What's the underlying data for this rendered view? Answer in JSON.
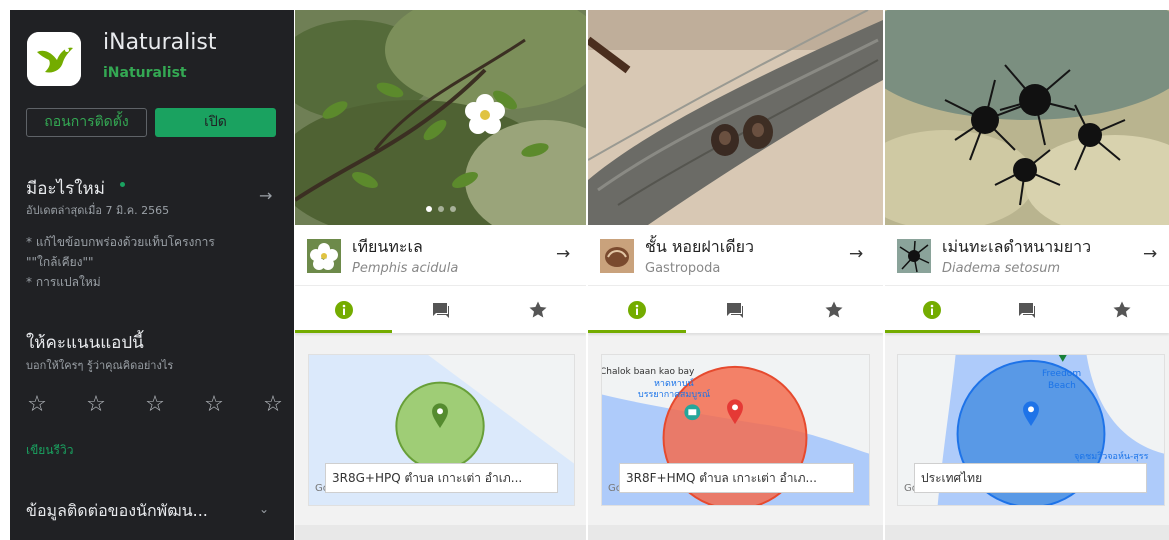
{
  "store": {
    "app_name": "iNaturalist",
    "developer": "iNaturalist",
    "uninstall_label": "ถอนการติดตั้ง",
    "open_label": "เปิด",
    "whats_new_title": "มีอะไรใหม่",
    "whats_new_arrow": "→",
    "whats_new_date": "อัปเดตล่าสุดเมื่อ 7 มิ.ค. 2565",
    "notes": [
      "* แก้ไขข้อบกพร่องด้วยแท็บโครงการ",
      "\"\"ใกล้เคียง\"\"",
      "* การแปลใหม่"
    ],
    "rate_title": "ให้คะแนนแอปนี้",
    "rate_subtitle": "บอกให้ใครๆ รู้ว่าคุณคิดอย่างไร",
    "stars": [
      "☆",
      "☆",
      "☆",
      "☆",
      "☆"
    ],
    "write_review_label": "เขียนรีวิว",
    "developer_contact_label": "ข้อมูลติดต่อของนักพัฒน...",
    "chevron": "⌄",
    "icons": {
      "app": "inaturalist-bird-icon",
      "star": "star-outline-icon",
      "arrow": "arrow-right-icon"
    },
    "colors": {
      "background": "#202124",
      "accent": "#1aa260"
    }
  },
  "cards": [
    {
      "taxon_name": "เทียนทะเล",
      "scientific_name": "Pemphis acidula",
      "arrow": "→",
      "photo_dots": 3,
      "map_address": "3R8G+HPQ ตำบล เกาะเต่า อำเภ...",
      "map_brand": "Google",
      "map_labels": [],
      "accuracy_color": "#8bc34a",
      "pin_color": "#558b2f"
    },
    {
      "taxon_name": "ชั้น หอยฝาเดียว",
      "scientific_name": "Gastropoda",
      "arrow": "→",
      "photo_dots": 0,
      "map_address": "3R8F+HMQ ตำบล เกาะเต่า อำเภ...",
      "map_brand": "Google",
      "map_labels": [
        "Chalok baan kao bay",
        "หาดหาบน์",
        "บรรยากาศสมบูรณ์"
      ],
      "accuracy_color": "#f36c4f",
      "pin_color": "#e53935"
    },
    {
      "taxon_name": "เม่นทะเลดำหนามยาว",
      "scientific_name": "Diadema setosum",
      "arrow": "→",
      "photo_dots": 0,
      "map_address": "ประเทศไทย",
      "map_brand": "Google",
      "map_labels": [
        "Freedom",
        "Beach",
        "จุดชมวิวจอห์น-สุรร"
      ],
      "accuracy_color": "#4a90e2",
      "pin_color": "#1e73e8"
    }
  ],
  "tabs_icons": [
    "info-icon",
    "comments-icon",
    "star-favorite-icon"
  ]
}
